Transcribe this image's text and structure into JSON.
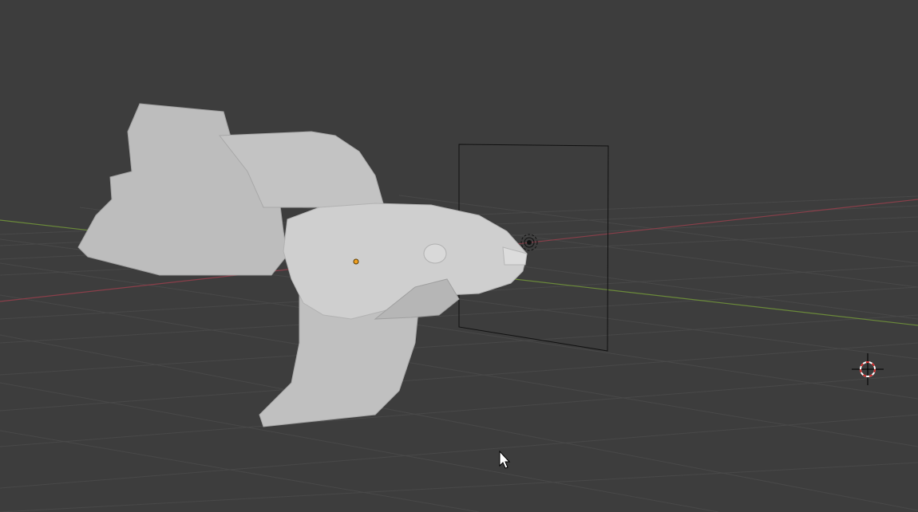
{
  "viewport": {
    "background_color": "#3d3d3d",
    "grid_color": "#4c4c4c",
    "x_axis_color": "#8a3f4a",
    "y_axis_color": "#6b8a3a"
  },
  "scene": {
    "mesh": {
      "name_icon": "fish-mesh",
      "color": "#c9c9c9",
      "shade_color": "#a9a9a9"
    },
    "origin": {
      "icon": "object-origin-dot",
      "color": "#f0a020"
    },
    "camera_frame": {
      "icon": "camera-frame",
      "color": "#111111"
    },
    "light": {
      "icon": "light-source-icon"
    },
    "cursor_3d": {
      "icon": "3d-cursor-icon",
      "colors": [
        "#ffffff",
        "#d02a2a"
      ]
    },
    "mouse_pointer": {
      "icon": "mouse-pointer-icon"
    }
  }
}
